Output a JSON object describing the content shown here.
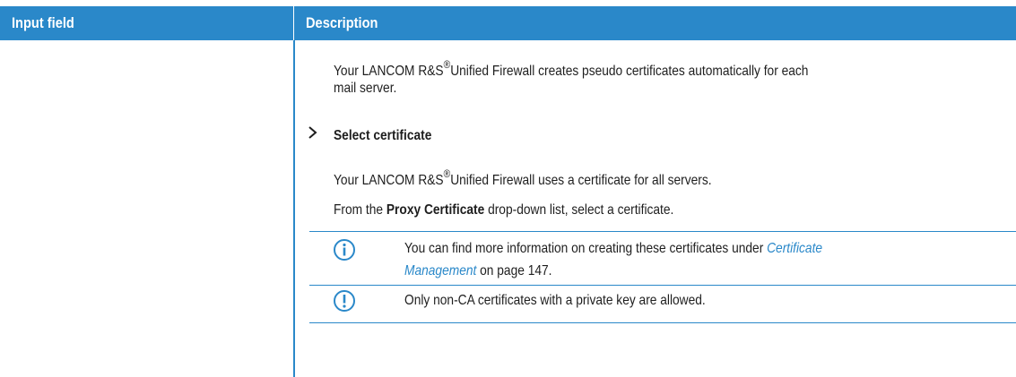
{
  "header": {
    "col1": "Input field",
    "col2": "Description"
  },
  "content": {
    "para1_line1_a": "Your LANCOM R&S",
    "para1_line1_reg": "®",
    "para1_line1_b": "Unified Firewall creates pseudo certificates automatically for each",
    "para1_line2": "mail server.",
    "option_title": "Select certificate",
    "para2_a": "Your LANCOM R&S",
    "para2_reg": "®",
    "para2_b": "Unified Firewall uses a certificate for all servers.",
    "para3_a": "From the ",
    "para3_bold": "Proxy Certificate",
    "para3_b": " drop-down list, select a certificate.",
    "info_note_line1_a": "You can find more information on creating these certificates under ",
    "info_note_link1": "Certificate",
    "info_note_link2": "Management",
    "info_note_line2_b": " on page 147.",
    "warning_note": "Only non-CA certificates with a private key are allowed."
  },
  "colors": {
    "accent": "#2a88c9",
    "text": "#1e1e1e",
    "link": "#2a88c9"
  },
  "icons": {
    "chevron": "chevron-right-icon",
    "info": "info-icon",
    "warning": "warning-icon"
  }
}
